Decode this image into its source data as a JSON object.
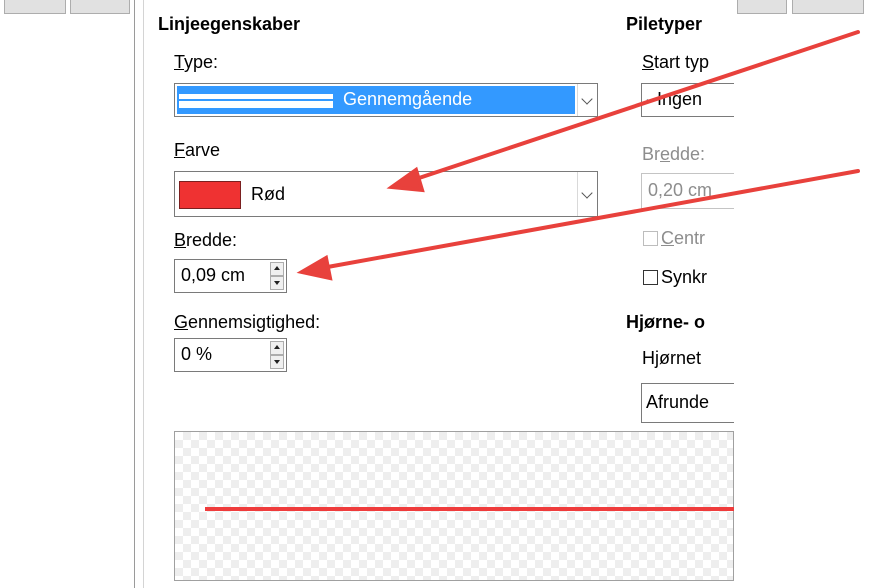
{
  "line_properties": {
    "heading": "Linjeegenskaber",
    "type_label_u": "T",
    "type_label_rest": "ype:",
    "type_value": "Gennemgående",
    "color_label_u": "F",
    "color_label_rest": "arve",
    "color_value": "Rød",
    "color_swatch": "#ef3232",
    "width_label_u": "B",
    "width_label_rest": "redde:",
    "width_value": "0,09 cm",
    "transparency_label_u": "G",
    "transparency_label_rest": "ennemsigtighed:",
    "transparency_value": "0 %"
  },
  "arrow_styles": {
    "heading": "Piletyper",
    "start_type_label_u": "S",
    "start_type_label_rest": "tart typ",
    "start_type_value": "- Ingen",
    "width_label_pre": "Br",
    "width_label_u": "e",
    "width_label_rest": "dde:",
    "width_value": "0,20 cm",
    "center_label_u": "C",
    "center_label_rest": "entr",
    "sync_label": "Synkr"
  },
  "corner_caps": {
    "heading": "Hjørne- o",
    "corner_label_pre": "H",
    "corner_label_u": "j",
    "corner_label_rest": "ørnet",
    "corner_value": "Afrunde"
  },
  "preview": {
    "line_color": "#ef3c3c"
  },
  "annotations": {
    "arrow_color": "#e8413c"
  }
}
